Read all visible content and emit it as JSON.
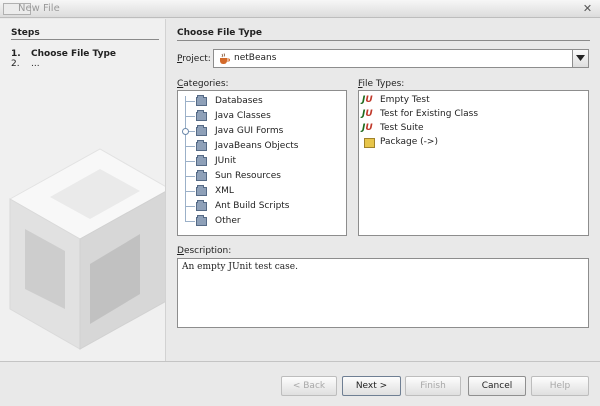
{
  "window": {
    "title": "New File",
    "close_glyph": "✕"
  },
  "steps": {
    "header": "Steps",
    "items": [
      {
        "num": "1.",
        "label": "Choose File Type"
      },
      {
        "num": "2.",
        "label": "..."
      }
    ]
  },
  "main": {
    "section_title": "Choose File Type",
    "project": {
      "label_mnemonic": "P",
      "label_rest": "roject:",
      "value": "netBeans",
      "icon": "coffee-cup-icon"
    },
    "categories": {
      "label_mnemonic": "C",
      "label_rest": "ategories:",
      "items": [
        {
          "label": "Databases",
          "expandable": false
        },
        {
          "label": "Java Classes",
          "expandable": false
        },
        {
          "label": "Java GUI Forms",
          "expandable": true
        },
        {
          "label": "JavaBeans Objects",
          "expandable": false
        },
        {
          "label": "JUnit",
          "expandable": false
        },
        {
          "label": "Sun Resources",
          "expandable": false
        },
        {
          "label": "XML",
          "expandable": false
        },
        {
          "label": "Ant Build Scripts",
          "expandable": false
        },
        {
          "label": "Other",
          "expandable": false
        }
      ]
    },
    "file_types": {
      "label_mnemonic": "F",
      "label_rest": "ile Types:",
      "items": [
        {
          "label": "Empty Test",
          "icon": "junit-icon"
        },
        {
          "label": "Test for Existing Class",
          "icon": "junit-icon"
        },
        {
          "label": "Test Suite",
          "icon": "junit-icon"
        },
        {
          "label": "Package (->)",
          "icon": "package-icon"
        }
      ]
    },
    "description": {
      "label_mnemonic": "D",
      "label_rest": "escription:",
      "text": "An empty JUnit test case."
    }
  },
  "buttons": {
    "back": "< Back",
    "next": "Next >",
    "finish": "Finish",
    "cancel": "Cancel",
    "help": "Help"
  },
  "colors": {
    "dialog_bg": "#e9e9e9",
    "folder": "#8ea0b8",
    "junit_green": "#1c6a1c",
    "junit_red": "#c0392b"
  }
}
